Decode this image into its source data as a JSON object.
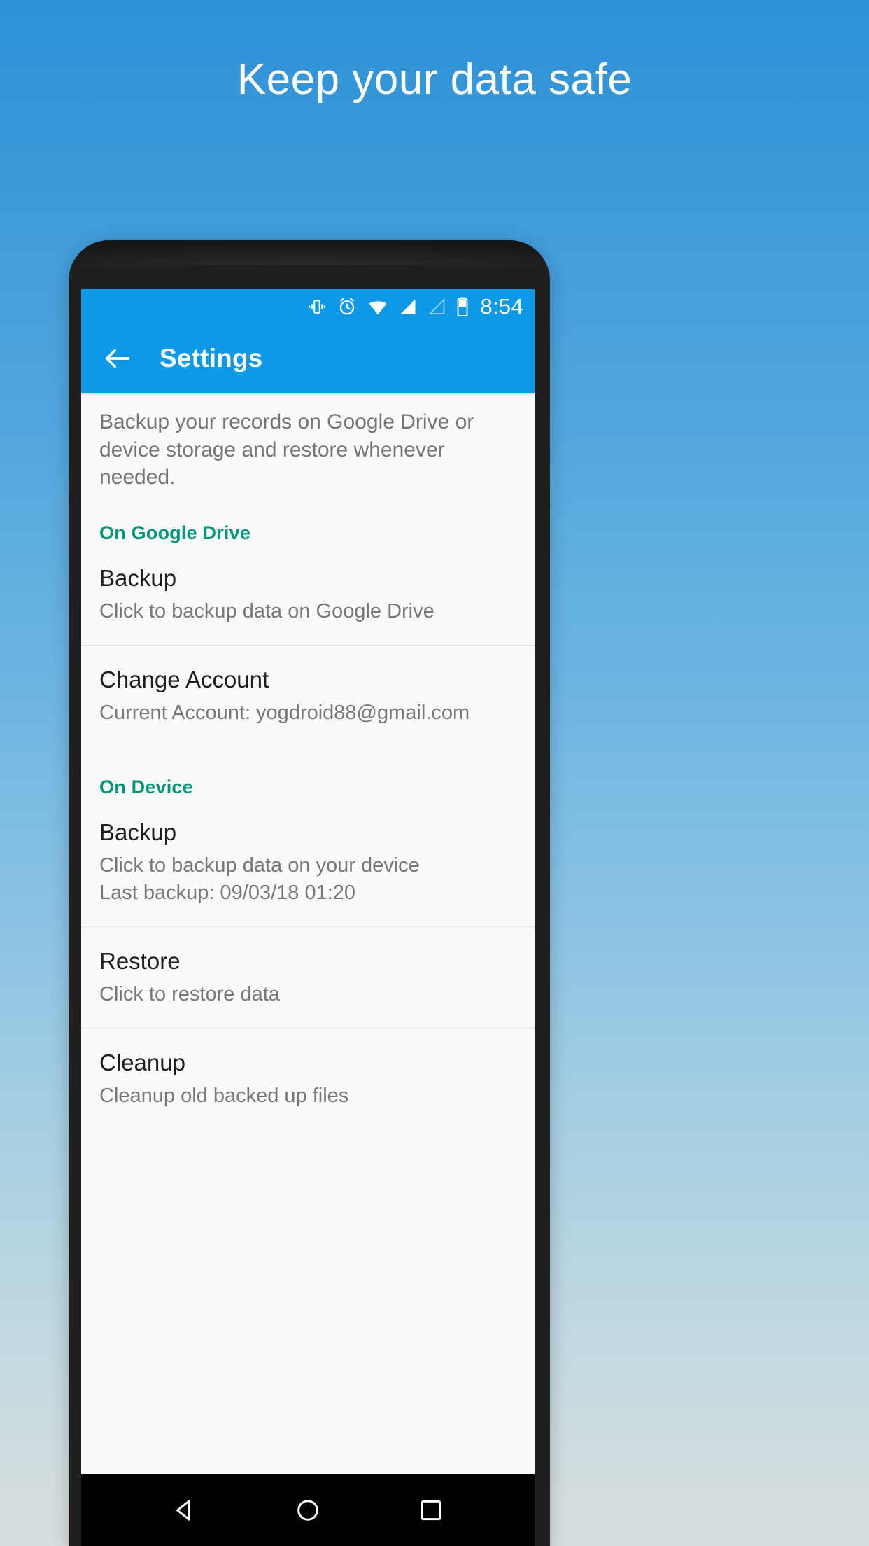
{
  "hero": {
    "title": "Keep your data safe"
  },
  "colors": {
    "background_top": "#2d92d8",
    "background_bottom": "#d7dee0",
    "app_bar": "#0d99e5",
    "section_header": "#009678",
    "screen_background": "#fafafa",
    "divider": "#e0e0e0",
    "nav_bar": "#000000",
    "bezel": "#1f1f1f"
  },
  "status_bar": {
    "clock": "8:54",
    "icons": [
      "vibrate-icon",
      "alarm-icon",
      "wifi-icon",
      "signal-full-icon",
      "signal-empty-icon",
      "battery-icon"
    ]
  },
  "app_bar": {
    "back_label": "back-arrow-icon",
    "title": "Settings"
  },
  "main": {
    "intro": "Backup your records on Google Drive or device storage and restore whenever needed.",
    "sections": [
      {
        "header": "On Google Drive",
        "items": [
          {
            "title": "Backup",
            "subtitle": "Click to backup data on Google Drive",
            "subtitle2": ""
          },
          {
            "title": "Change Account",
            "subtitle": "Current Account: yogdroid88@gmail.com",
            "subtitle2": ""
          }
        ]
      },
      {
        "header": "On Device",
        "items": [
          {
            "title": "Backup",
            "subtitle": "Click to backup data on your device",
            "subtitle2": "Last backup: 09/03/18 01:20"
          },
          {
            "title": "Restore",
            "subtitle": "Click to restore data",
            "subtitle2": ""
          },
          {
            "title": "Cleanup",
            "subtitle": "Cleanup old backed up files",
            "subtitle2": ""
          }
        ]
      }
    ]
  },
  "nav_bar": {
    "buttons": [
      {
        "name": "back-triangle-icon"
      },
      {
        "name": "home-circle-icon"
      },
      {
        "name": "recents-square-icon"
      }
    ]
  }
}
